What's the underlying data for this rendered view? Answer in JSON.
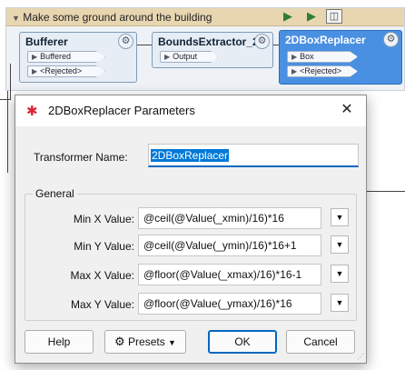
{
  "canvas": {
    "bookmark_title": "Make some ground around the building",
    "bookmark_tools": [
      "run-from-here",
      "run-to-here",
      "bookmark-view"
    ],
    "transformers": [
      {
        "title": "Bufferer",
        "ports": [
          "Buffered",
          "<Rejected>"
        ],
        "selected": false
      },
      {
        "title": "BoundsExtractor_2",
        "ports": [
          "Output"
        ],
        "selected": false
      },
      {
        "title": "2DBoxReplacer",
        "ports": [
          "Box",
          "<Rejected>"
        ],
        "selected": true
      }
    ]
  },
  "dialog": {
    "title": "2DBoxReplacer Parameters",
    "close": "✕",
    "transformer_name_label": "Transformer Name:",
    "transformer_name_value": "2DBoxReplacer",
    "group_label": "General",
    "params": [
      {
        "label": "Min X Value:",
        "value": "@ceil(@Value(_xmin)/16)*16"
      },
      {
        "label": "Min Y Value:",
        "value": "@ceil(@Value(_ymin)/16)*16+1"
      },
      {
        "label": "Max X Value:",
        "value": "@floor(@Value(_xmax)/16)*16-1"
      },
      {
        "label": "Max Y Value:",
        "value": "@floor(@Value(_ymax)/16)*16"
      }
    ],
    "buttons": {
      "help": "Help",
      "presets": "Presets",
      "ok": "OK",
      "cancel": "Cancel"
    }
  }
}
